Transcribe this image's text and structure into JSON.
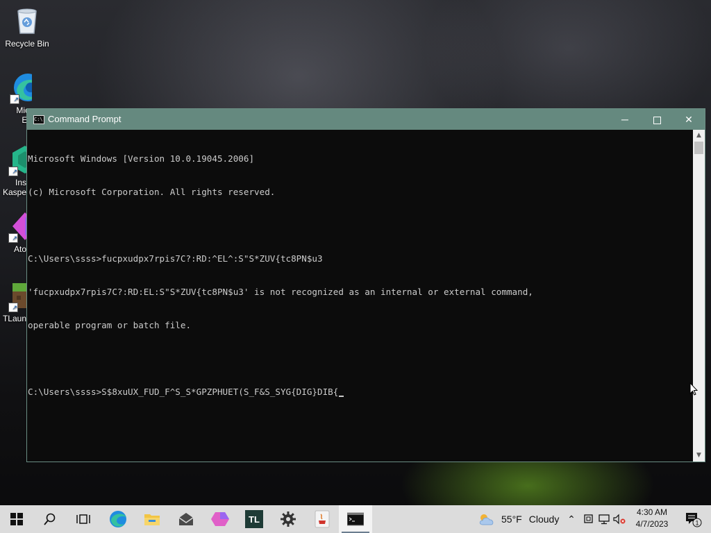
{
  "desktop": {
    "icons": [
      {
        "label": "Recycle Bin"
      },
      {
        "label": "Micr\nEd"
      },
      {
        "label": "Ins\nKaspe"
      },
      {
        "label": "Ato"
      },
      {
        "label": "TLaun"
      }
    ]
  },
  "window": {
    "title": "Command Prompt",
    "minimize_label": "─",
    "close_label": "✕",
    "lines": [
      "Microsoft Windows [Version 10.0.19045.2006]",
      "(c) Microsoft Corporation. All rights reserved.",
      "",
      "C:\\Users\\ssss>fucpxudpx7rpis7C?:RD:^EL^:S\"S*ZUV{tc8PN$u3",
      "'fucpxudpx7rpis7C?:RD:EL:S\"S*ZUV{tc8PN$u3' is not recognized as an internal or external command,",
      "operable program or batch file.",
      "",
      "C:\\Users\\ssss>S$8xuUX_FUD_F^S_S*GPZPHUET(S_F&S_SYG{DIG}DIB{"
    ]
  },
  "taskbar": {
    "weather": {
      "temp": "55°F",
      "condition": "Cloudy"
    },
    "clock": {
      "time": "4:30 AM",
      "date": "4/7/2023"
    },
    "notifications_count": "1",
    "colors": {
      "accent": "#65897f",
      "taskbar_bg": "#dcdcdc"
    },
    "buttons": [
      {
        "icon": "windows-start-icon"
      },
      {
        "icon": "search-icon"
      },
      {
        "icon": "task-view-icon"
      },
      {
        "icon": "edge-icon"
      },
      {
        "icon": "file-explorer-icon"
      },
      {
        "icon": "mail-icon"
      },
      {
        "icon": "atom-icon"
      },
      {
        "icon": "tlauncher-icon",
        "text": "TL"
      },
      {
        "icon": "settings-gear-icon"
      },
      {
        "icon": "java-icon"
      },
      {
        "icon": "command-prompt-icon"
      }
    ]
  }
}
